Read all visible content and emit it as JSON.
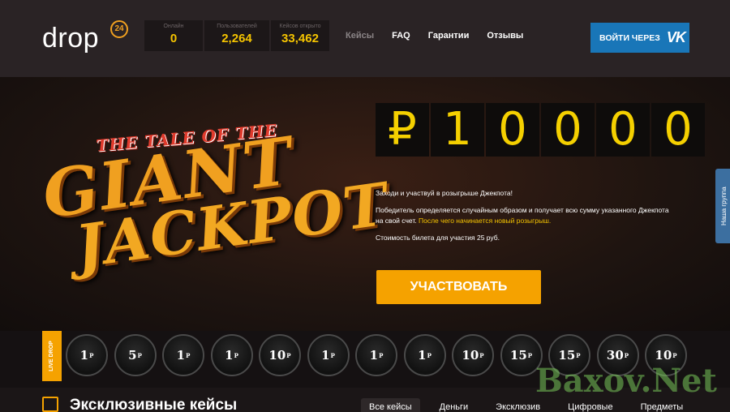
{
  "header": {
    "logo": "drop",
    "logo_badge": "24",
    "stats": [
      {
        "label": "Онлайн",
        "value": "0"
      },
      {
        "label": "Пользователей",
        "value": "2,264"
      },
      {
        "label": "Кейсов открыто",
        "value": "33,462"
      }
    ],
    "nav": [
      "Кейсы",
      "FAQ",
      "Гарантии",
      "Отзывы"
    ],
    "login_label": "ВОЙТИ ЧЕРЕЗ",
    "login_icon": "VK"
  },
  "hero": {
    "logo_line1": "THE TALE OF THE",
    "logo_line2": "GIANT",
    "logo_line3": "JACKPOT",
    "digits": [
      "₽",
      "1",
      "0",
      "0",
      "0",
      "0"
    ],
    "text1": "Заходи и участвуй в розыгрыше Джекпота!",
    "text2": "Победитель определяется случайным образом и получает всю сумму указанного Джекпота на свой счет.",
    "text2_highlight": "После чего начинается новый розыгрыш.",
    "text3": "Стоимость билета для участия 25 руб.",
    "button": "УЧАСТВОВАТЬ"
  },
  "side_widget": {
    "label": "Наша группа",
    "icon": "VK"
  },
  "live_drop": {
    "label": "LIVE DROP",
    "coins": [
      "1",
      "5",
      "1",
      "1",
      "10",
      "1",
      "1",
      "1",
      "10",
      "15",
      "15",
      "30",
      "10"
    ],
    "currency": "Р"
  },
  "cases": {
    "title": "Эксклюзивные кейсы",
    "tabs": [
      "Все кейсы",
      "Деньги",
      "Эксклюзив",
      "Цифровые",
      "Предметы"
    ]
  },
  "watermark": "Baxov.Net"
}
